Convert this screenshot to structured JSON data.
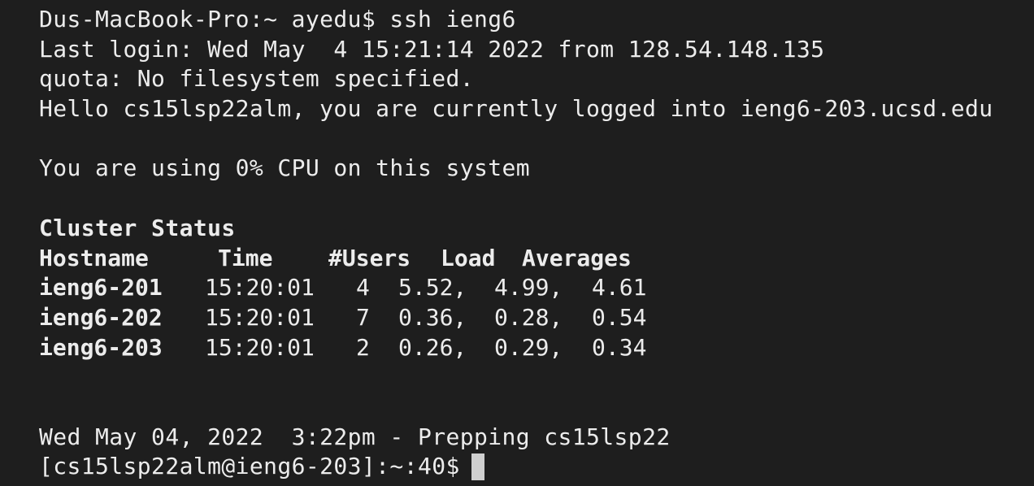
{
  "terminal": {
    "lines": {
      "cmd": "Dus-MacBook-Pro:~ ayedu$ ssh ieng6",
      "last_login": "Last login: Wed May  4 15:21:14 2022 from 128.54.148.135",
      "quota": "quota: No filesystem specified.",
      "hello": "Hello cs15lsp22alm, you are currently logged into ieng6-203.ucsd.edu",
      "cpu": "You are using 0% CPU on this system",
      "cluster_title": "Cluster Status",
      "date_line": "Wed May 04, 2022  3:22pm - Prepping cs15lsp22",
      "prompt": "[cs15lsp22alm@ieng6-203]:~:40$"
    },
    "table": {
      "headers": {
        "hostname": "Hostname",
        "time": "Time",
        "users": "#Users",
        "load": "Load",
        "averages": "Averages"
      },
      "rows": [
        {
          "host": "ieng6-201",
          "time": "15:20:01",
          "users": "4",
          "l1": "5.52,",
          "l5": "4.99,",
          "l15": "4.61"
        },
        {
          "host": "ieng6-202",
          "time": "15:20:01",
          "users": "7",
          "l1": "0.36,",
          "l5": "0.28,",
          "l15": "0.54"
        },
        {
          "host": "ieng6-203",
          "time": "15:20:01",
          "users": "2",
          "l1": "0.26,",
          "l5": "0.29,",
          "l15": "0.34"
        }
      ]
    }
  }
}
